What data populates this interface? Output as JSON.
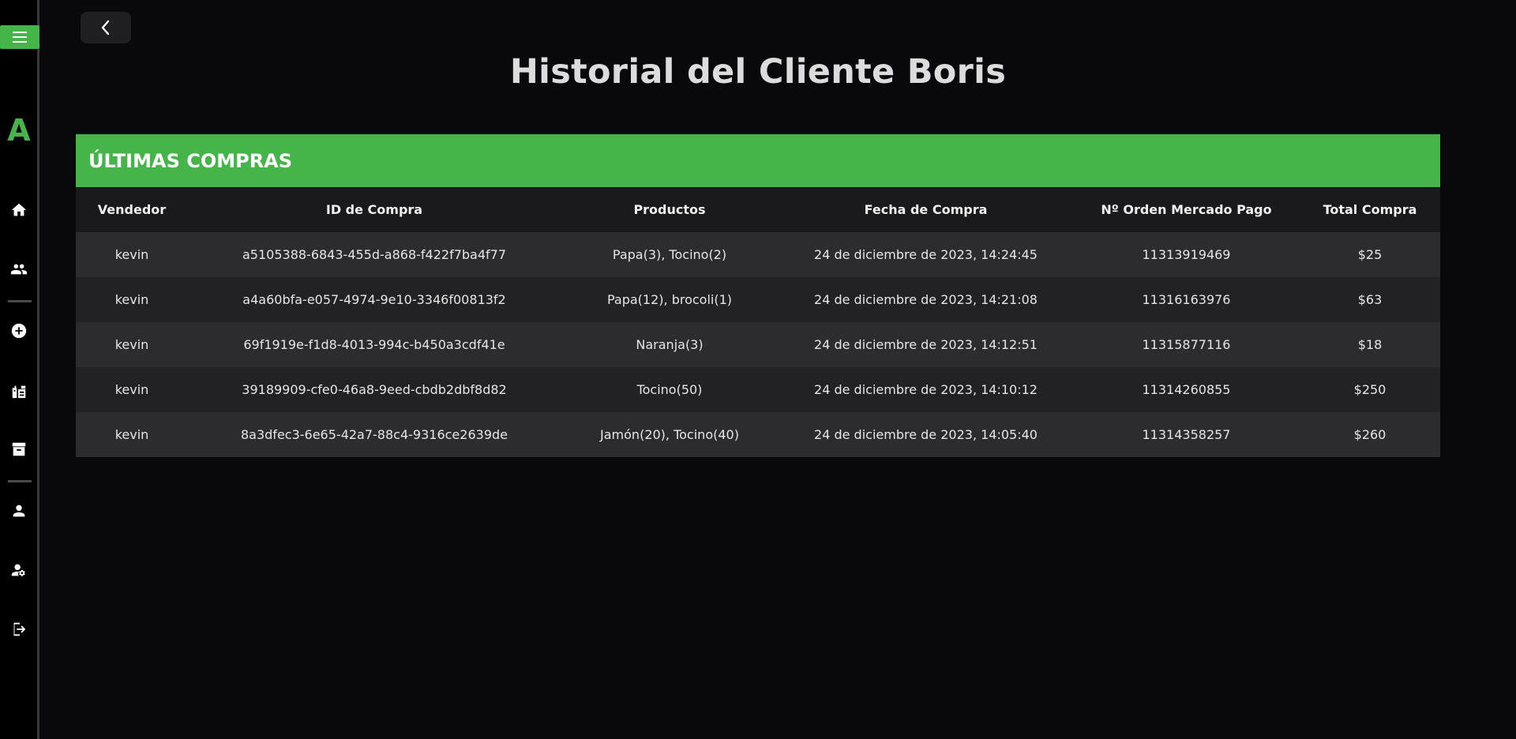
{
  "sidebar": {
    "logo": "A",
    "icons": [
      "home-icon",
      "clients-icon",
      "add-circle-icon",
      "products-icon",
      "archive-icon",
      "user-icon",
      "user-settings-icon",
      "logout-icon"
    ]
  },
  "accent_color": "#45b54a",
  "page": {
    "title": "Historial del Cliente Boris"
  },
  "purchases": {
    "header": "ÚLTIMAS COMPRAS",
    "columns": [
      "Vendedor",
      "ID de Compra",
      "Productos",
      "Fecha de Compra",
      "Nº Orden Mercado Pago",
      "Total Compra"
    ],
    "rows": [
      {
        "vendedor": "kevin",
        "id": "a5105388-6843-455d-a868-f422f7ba4f77",
        "productos": "Papa(3), Tocino(2)",
        "fecha": "24 de diciembre de 2023, 14:24:45",
        "orden": "11313919469",
        "total": "$25"
      },
      {
        "vendedor": "kevin",
        "id": "a4a60bfa-e057-4974-9e10-3346f00813f2",
        "productos": "Papa(12), brocoli(1)",
        "fecha": "24 de diciembre de 2023, 14:21:08",
        "orden": "11316163976",
        "total": "$63"
      },
      {
        "vendedor": "kevin",
        "id": "69f1919e-f1d8-4013-994c-b450a3cdf41e",
        "productos": "Naranja(3)",
        "fecha": "24 de diciembre de 2023, 14:12:51",
        "orden": "11315877116",
        "total": "$18"
      },
      {
        "vendedor": "kevin",
        "id": "39189909-cfe0-46a8-9eed-cbdb2dbf8d82",
        "productos": "Tocino(50)",
        "fecha": "24 de diciembre de 2023, 14:10:12",
        "orden": "11314260855",
        "total": "$250"
      },
      {
        "vendedor": "kevin",
        "id": "8a3dfec3-6e65-42a7-88c4-9316ce2639de",
        "productos": "Jamón(20), Tocino(40)",
        "fecha": "24 de diciembre de 2023, 14:05:40",
        "orden": "11314358257",
        "total": "$260"
      }
    ]
  }
}
